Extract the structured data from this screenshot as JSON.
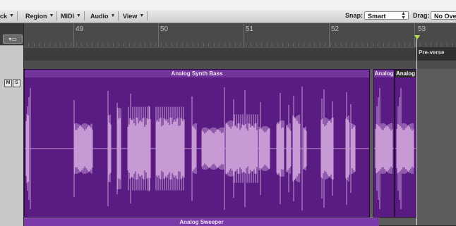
{
  "toolbar": {
    "menus": [
      {
        "label": "ck"
      },
      {
        "label": "Region"
      },
      {
        "label": "MIDI"
      },
      {
        "label": "Audio"
      },
      {
        "label": "View"
      }
    ],
    "snap_label": "Snap:",
    "snap_value": "Smart",
    "drag_label": "Drag:",
    "drag_value": "No Over"
  },
  "ruler": {
    "bars": [
      "49",
      "50",
      "51",
      "52",
      "53"
    ]
  },
  "markers": {
    "current": "Pre-verse"
  },
  "track": {
    "mute_label": "M",
    "solo_label": "S"
  },
  "regions": [
    {
      "name": "Analog Synth Bass"
    },
    {
      "name": "Analog"
    },
    {
      "name": "Analog"
    }
  ],
  "next_region": {
    "name": "Analog Sweeper"
  },
  "colors": {
    "region": "#60208a",
    "waveform": "#c79ad6",
    "playhead_marker": "#b6e058"
  },
  "icons": {
    "track_select": "window-icon",
    "menu_arrow": "triangle-down-icon",
    "stepper": "up-down-icon",
    "playhead": "playhead-triangle-icon"
  }
}
